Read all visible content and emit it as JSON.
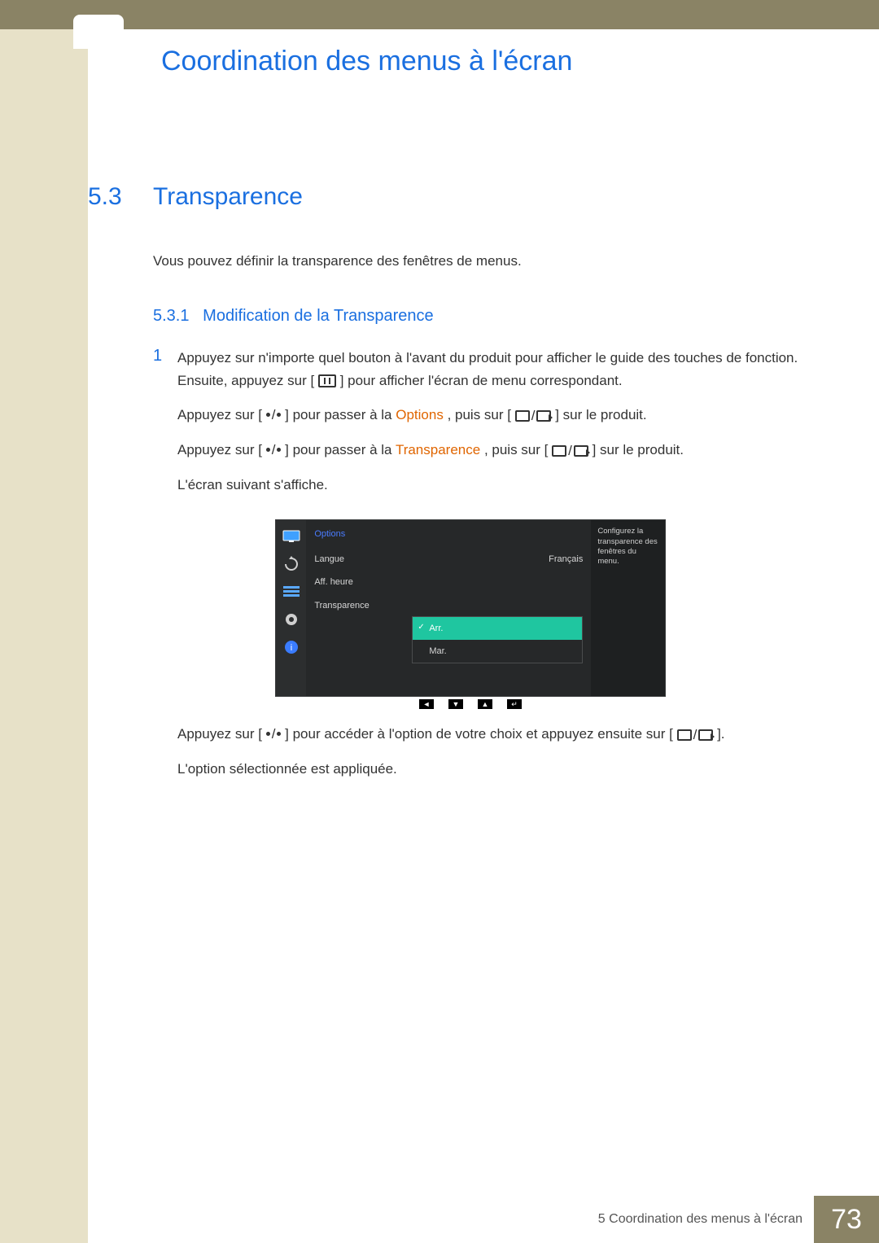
{
  "doc": {
    "title": "Coordination des menus à l'écran",
    "section_num": "5.3",
    "section_title": "Transparence",
    "intro": "Vous pouvez définir la transparence des fenêtres de menus.",
    "subsection_num": "5.3.1",
    "subsection_title": "Modification de la Transparence"
  },
  "steps": {
    "s1_num": "1",
    "s1a": "Appuyez sur n'importe quel bouton à l'avant du produit pour afficher le guide des touches de fonction. Ensuite, appuyez sur [",
    "s1b": "] pour afficher l'écran de menu correspondant.",
    "s2a": "Appuyez sur [",
    "s2b": "] pour passer à la ",
    "s2_hl": "Options",
    "s2c": ", puis sur [",
    "s2d": "] sur le produit.",
    "s3a": "Appuyez sur [",
    "s3b": "] pour passer à la ",
    "s3_hl": "Transparence",
    "s3c": ", puis sur [",
    "s3d": "] sur le produit.",
    "s4": "L'écran suivant s'affiche.",
    "s5a": "Appuyez sur [",
    "s5b": "] pour accéder à l'option de votre choix et appuyez ensuite sur [",
    "s5c": "].",
    "s6": "L'option sélectionnée est appliquée."
  },
  "osd": {
    "menu_title": "Options",
    "row_langue": "Langue",
    "row_langue_val": "Français",
    "row_aff": "Aff. heure",
    "row_transp": "Transparence",
    "opt_off": "Arr.",
    "opt_on": "Mar.",
    "help": "Configurez la transparence des fenêtres du menu."
  },
  "footer": {
    "chapter": "5 Coordination des menus à l'écran",
    "page": "73"
  },
  "icons": {
    "menu": "menu-icon",
    "enter_pair": "enter-source-icon-pair",
    "monitor": "monitor-icon",
    "rotate": "rotate-icon",
    "list": "list-icon",
    "gear": "gear-icon",
    "info": "info-icon",
    "nav_left": "◄",
    "nav_down": "▼",
    "nav_up": "▲",
    "nav_enter": "↵"
  }
}
